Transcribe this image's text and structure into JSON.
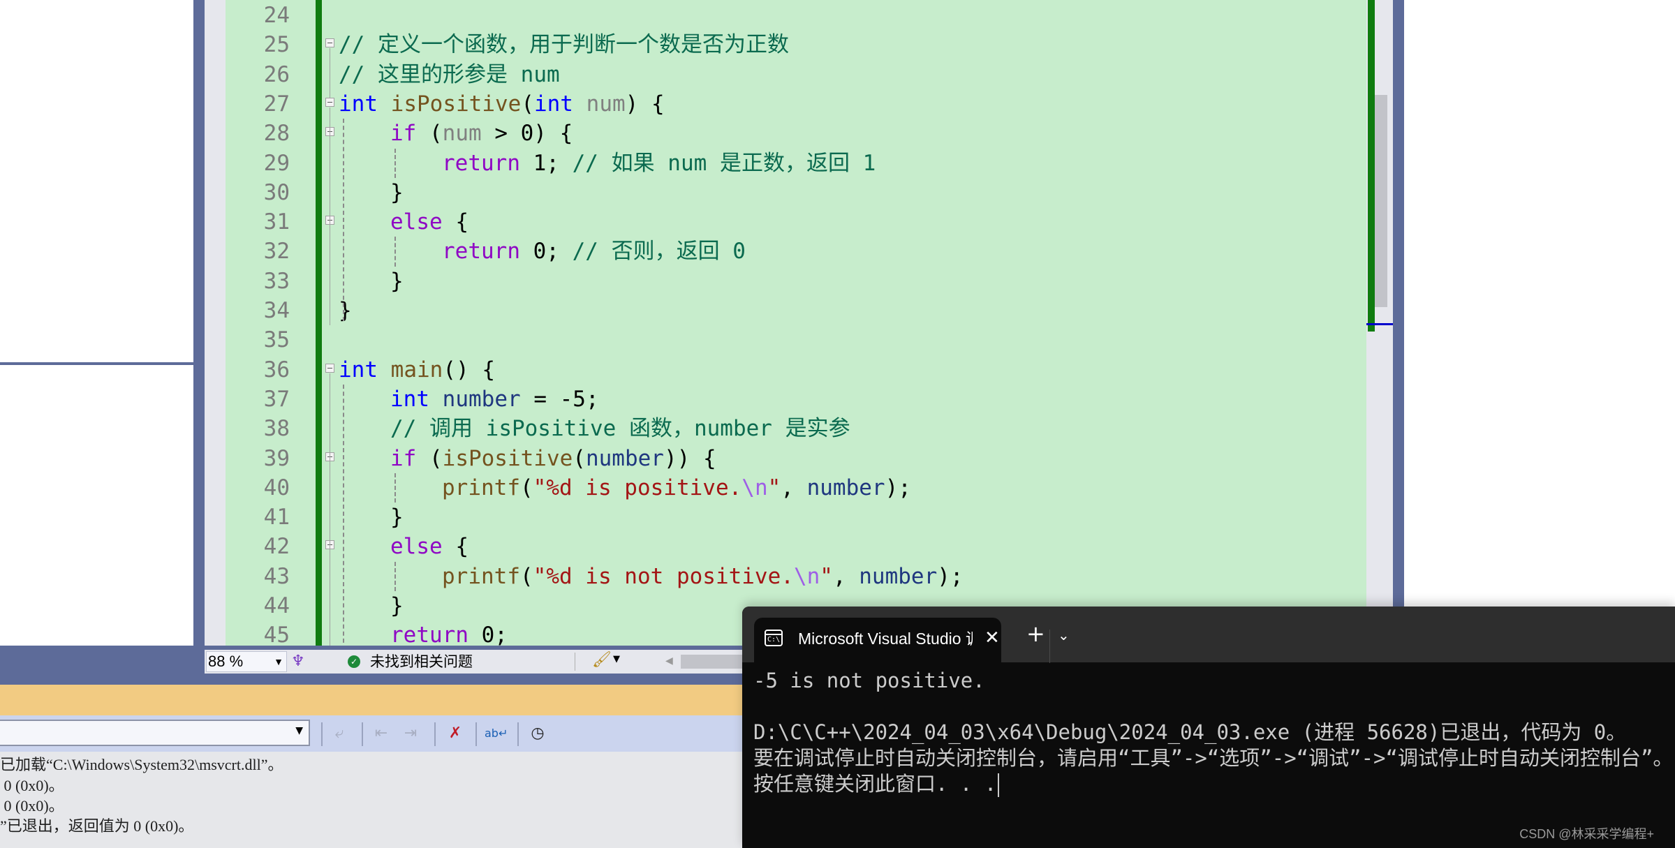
{
  "editor": {
    "lines": [
      {
        "n": "24",
        "tokens": []
      },
      {
        "n": "25",
        "fold": true,
        "tokens": [
          {
            "c": "cm",
            "t": "// 定义一个函数，用于判断一个数是否为正数"
          }
        ]
      },
      {
        "n": "26",
        "tokens": [
          {
            "c": "cm",
            "t": "// 这里的形参是 num"
          }
        ]
      },
      {
        "n": "27",
        "fold": true,
        "tokens": [
          {
            "c": "kw",
            "t": "int"
          },
          {
            "c": "pl",
            "t": " "
          },
          {
            "c": "fn",
            "t": "isPositive"
          },
          {
            "c": "pl",
            "t": "("
          },
          {
            "c": "kw",
            "t": "int"
          },
          {
            "c": "pl",
            "t": " "
          },
          {
            "c": "param",
            "t": "num"
          },
          {
            "c": "pl",
            "t": ") {"
          }
        ]
      },
      {
        "n": "28",
        "fold": true,
        "indent": 1,
        "tokens": [
          {
            "c": "ctl",
            "t": "if"
          },
          {
            "c": "pl",
            "t": " ("
          },
          {
            "c": "param",
            "t": "num"
          },
          {
            "c": "pl",
            "t": " > 0) {"
          }
        ]
      },
      {
        "n": "29",
        "indent": 2,
        "tokens": [
          {
            "c": "ctl",
            "t": "return"
          },
          {
            "c": "pl",
            "t": " 1; "
          },
          {
            "c": "cm",
            "t": "// 如果 num 是正数，返回 1"
          }
        ]
      },
      {
        "n": "30",
        "indent": 1,
        "tokens": [
          {
            "c": "pl",
            "t": "}"
          }
        ]
      },
      {
        "n": "31",
        "fold": true,
        "indent": 1,
        "tokens": [
          {
            "c": "ctl",
            "t": "else"
          },
          {
            "c": "pl",
            "t": " {"
          }
        ]
      },
      {
        "n": "32",
        "indent": 2,
        "tokens": [
          {
            "c": "ctl",
            "t": "return"
          },
          {
            "c": "pl",
            "t": " 0; "
          },
          {
            "c": "cm",
            "t": "// 否则，返回 0"
          }
        ]
      },
      {
        "n": "33",
        "indent": 1,
        "tokens": [
          {
            "c": "pl",
            "t": "}"
          }
        ]
      },
      {
        "n": "34",
        "tokens": [
          {
            "c": "pl",
            "t": "}"
          }
        ]
      },
      {
        "n": "35",
        "tokens": []
      },
      {
        "n": "36",
        "fold": true,
        "tokens": [
          {
            "c": "kw",
            "t": "int"
          },
          {
            "c": "pl",
            "t": " "
          },
          {
            "c": "fn",
            "t": "main"
          },
          {
            "c": "pl",
            "t": "() {"
          }
        ]
      },
      {
        "n": "37",
        "indent": 1,
        "tokens": [
          {
            "c": "kw",
            "t": "int"
          },
          {
            "c": "pl",
            "t": " "
          },
          {
            "c": "var",
            "t": "number"
          },
          {
            "c": "pl",
            "t": " = -5;"
          }
        ]
      },
      {
        "n": "38",
        "indent": 1,
        "tokens": [
          {
            "c": "cm",
            "t": "// 调用 isPositive 函数，number 是实参"
          }
        ]
      },
      {
        "n": "39",
        "fold": true,
        "indent": 1,
        "tokens": [
          {
            "c": "ctl",
            "t": "if"
          },
          {
            "c": "pl",
            "t": " ("
          },
          {
            "c": "fn",
            "t": "isPositive"
          },
          {
            "c": "pl",
            "t": "("
          },
          {
            "c": "var",
            "t": "number"
          },
          {
            "c": "pl",
            "t": ")) {"
          }
        ]
      },
      {
        "n": "40",
        "indent": 2,
        "tokens": [
          {
            "c": "fn",
            "t": "printf"
          },
          {
            "c": "pl",
            "t": "("
          },
          {
            "c": "str",
            "t": "\"%d is positive."
          },
          {
            "c": "esc",
            "t": "\\n"
          },
          {
            "c": "str",
            "t": "\""
          },
          {
            "c": "pl",
            "t": ", "
          },
          {
            "c": "var",
            "t": "number"
          },
          {
            "c": "pl",
            "t": ");"
          }
        ]
      },
      {
        "n": "41",
        "indent": 1,
        "tokens": [
          {
            "c": "pl",
            "t": "}"
          }
        ]
      },
      {
        "n": "42",
        "fold": true,
        "indent": 1,
        "tokens": [
          {
            "c": "ctl",
            "t": "else"
          },
          {
            "c": "pl",
            "t": " {"
          }
        ]
      },
      {
        "n": "43",
        "indent": 2,
        "tokens": [
          {
            "c": "fn",
            "t": "printf"
          },
          {
            "c": "pl",
            "t": "("
          },
          {
            "c": "str",
            "t": "\"%d is not positive."
          },
          {
            "c": "esc",
            "t": "\\n"
          },
          {
            "c": "str",
            "t": "\""
          },
          {
            "c": "pl",
            "t": ", "
          },
          {
            "c": "var",
            "t": "number"
          },
          {
            "c": "pl",
            "t": ");"
          }
        ]
      },
      {
        "n": "44",
        "indent": 1,
        "tokens": [
          {
            "c": "pl",
            "t": "}"
          }
        ]
      },
      {
        "n": "45",
        "indent": 1,
        "tokens": [
          {
            "c": "ctl",
            "t": "return"
          },
          {
            "c": "pl",
            "t": " 0;"
          }
        ]
      }
    ]
  },
  "status_bar": {
    "zoom_level": "88 %",
    "issues_text": "未找到相关问题"
  },
  "output_pane": {
    "source_selected": "",
    "lines": [
      "已加载“C:\\Windows\\System32\\msvcrt.dll”。",
      " 0 (0x0)。",
      " 0 (0x0)。",
      "”已退出，返回值为 0 (0x0)。"
    ]
  },
  "terminal": {
    "tab_title": "Microsoft Visual Studio 调试控制台",
    "tab_icon_text": "C:\\",
    "lines": [
      "-5 is not positive.",
      "",
      "D:\\C\\C++\\2024_04_03\\x64\\Debug\\2024_04_03.exe (进程 56628)已退出，代码为 0。",
      "要在调试停止时自动关闭控制台，请启用“工具”->“选项”->“调试”->“调试停止时自动关闭控制台”。",
      "按任意键关闭此窗口. . ."
    ]
  },
  "watermark": "CSDN @林采采学编程+",
  "colors": {
    "editor_bg": "#c7edcc",
    "frame_blue": "#5d6b99",
    "change_bar": "#107c10",
    "output_header": "#f2cb82",
    "terminal_bg": "#0c0c0c"
  }
}
